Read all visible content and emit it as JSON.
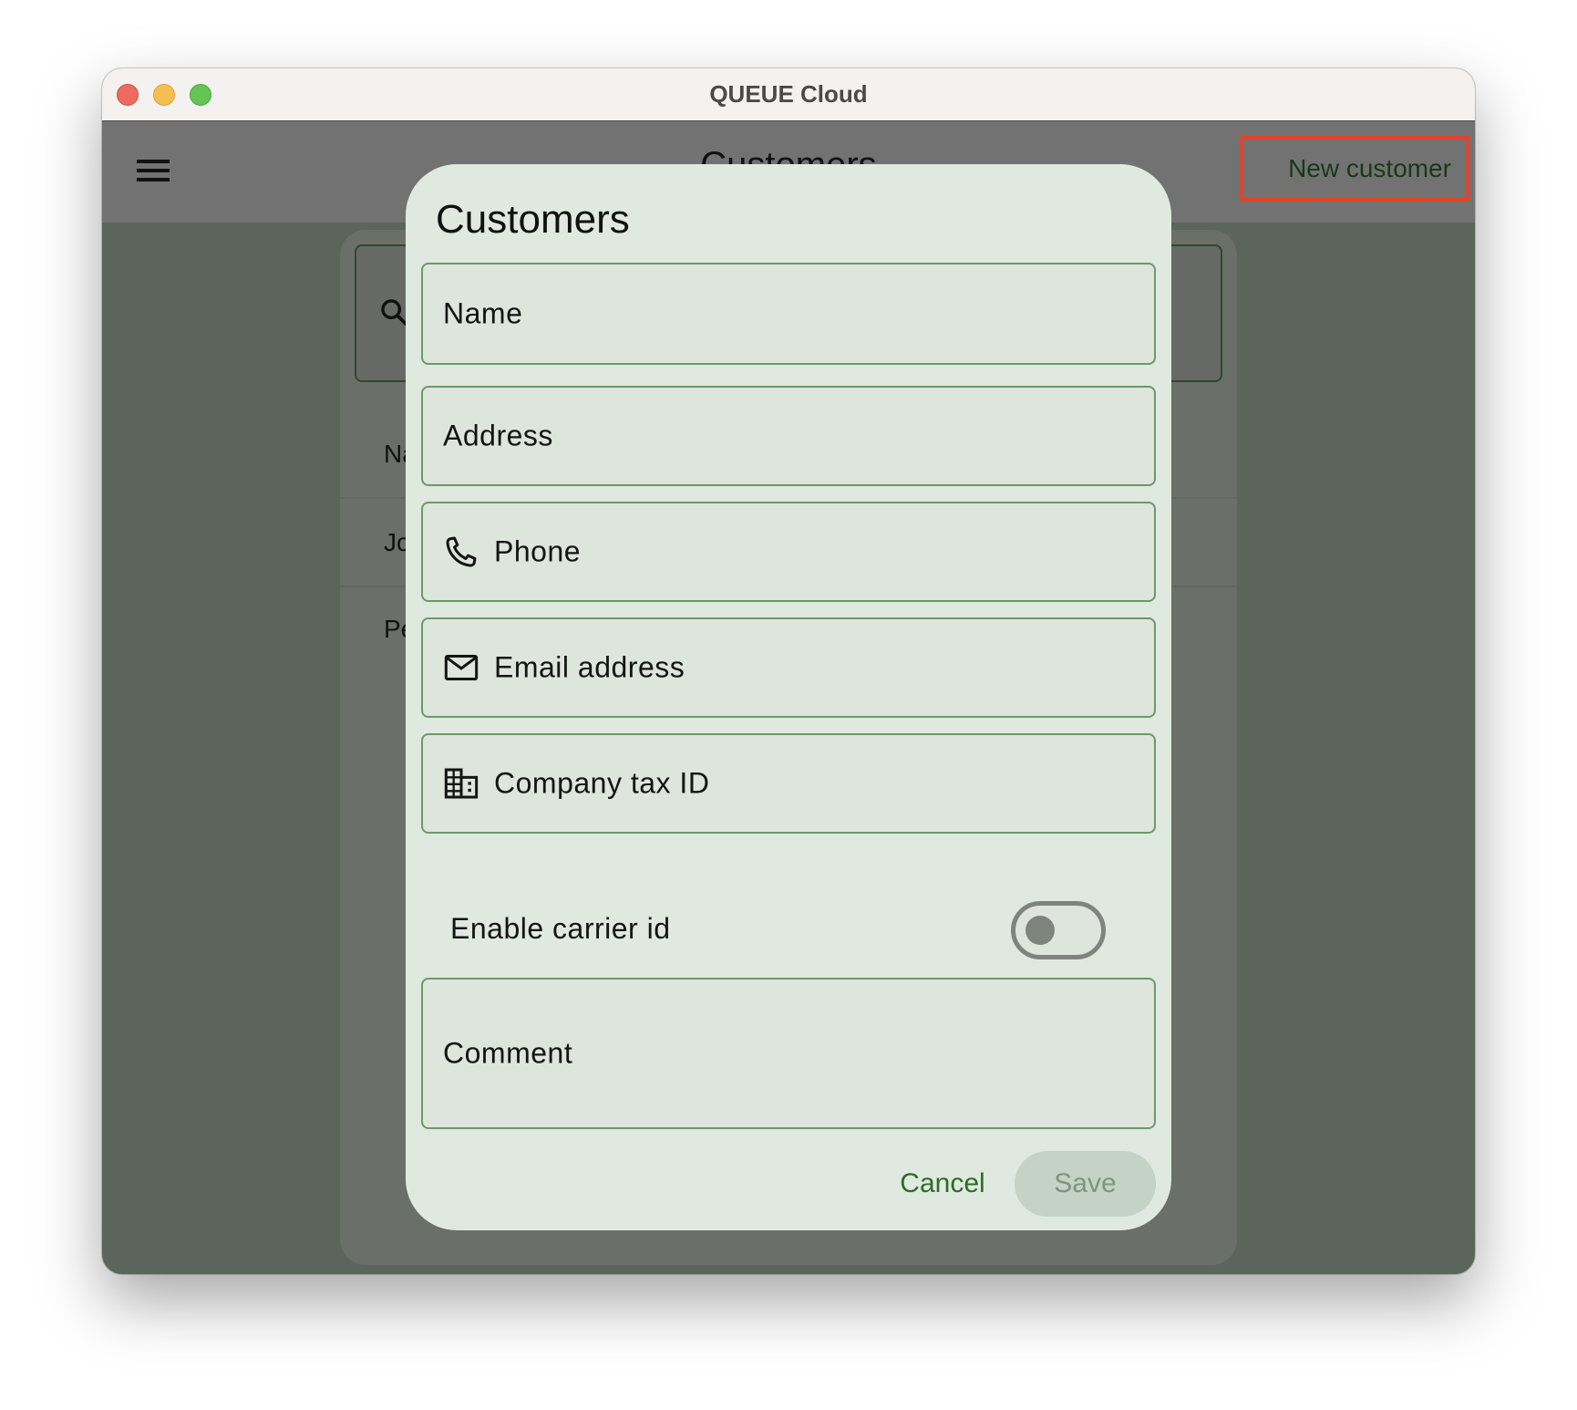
{
  "window": {
    "title": "QUEUE Cloud",
    "controls": [
      "close",
      "minimize",
      "zoom"
    ]
  },
  "appbar": {
    "menu_icon": "hamburger-icon",
    "title": "Customers",
    "new_customer_label": "New customer",
    "highlight_color": "#e3432a"
  },
  "background_list": {
    "search_icon": "search-icon",
    "rows": [
      {
        "text": "Na"
      },
      {
        "text": "Jo"
      },
      {
        "text": "Pe"
      }
    ]
  },
  "dialog": {
    "title": "Customers",
    "fields": [
      {
        "label": "Name",
        "icon": null
      },
      {
        "label": "Address",
        "icon": null
      },
      {
        "label": "Phone",
        "icon": "phone-icon"
      },
      {
        "label": "Email address",
        "icon": "mail-icon"
      },
      {
        "label": "Company tax ID",
        "icon": "building-icon"
      }
    ],
    "toggle": {
      "label": "Enable carrier id",
      "checked": false
    },
    "comment": {
      "label": "Comment"
    },
    "cancel_label": "Cancel",
    "save_label": "Save",
    "save_enabled": false,
    "accent_color": "#2d6c27"
  }
}
